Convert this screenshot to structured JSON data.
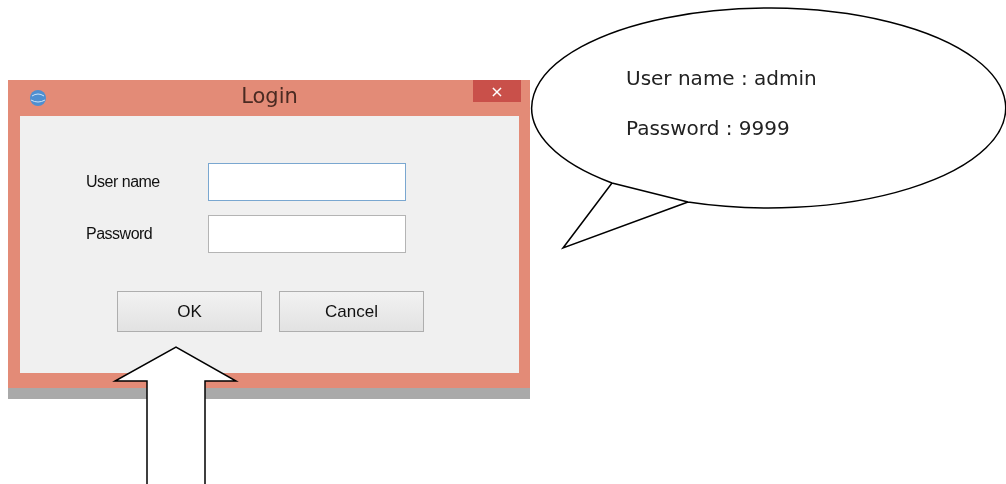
{
  "window": {
    "title": "Login",
    "close_glyph": "×"
  },
  "fields": [
    {
      "label": "User name",
      "focused": true
    },
    {
      "label": "Password",
      "focused": false
    }
  ],
  "buttons": [
    "OK",
    "Cancel"
  ],
  "callout": {
    "lines": [
      "User name : admin",
      "Password : 9999"
    ]
  }
}
